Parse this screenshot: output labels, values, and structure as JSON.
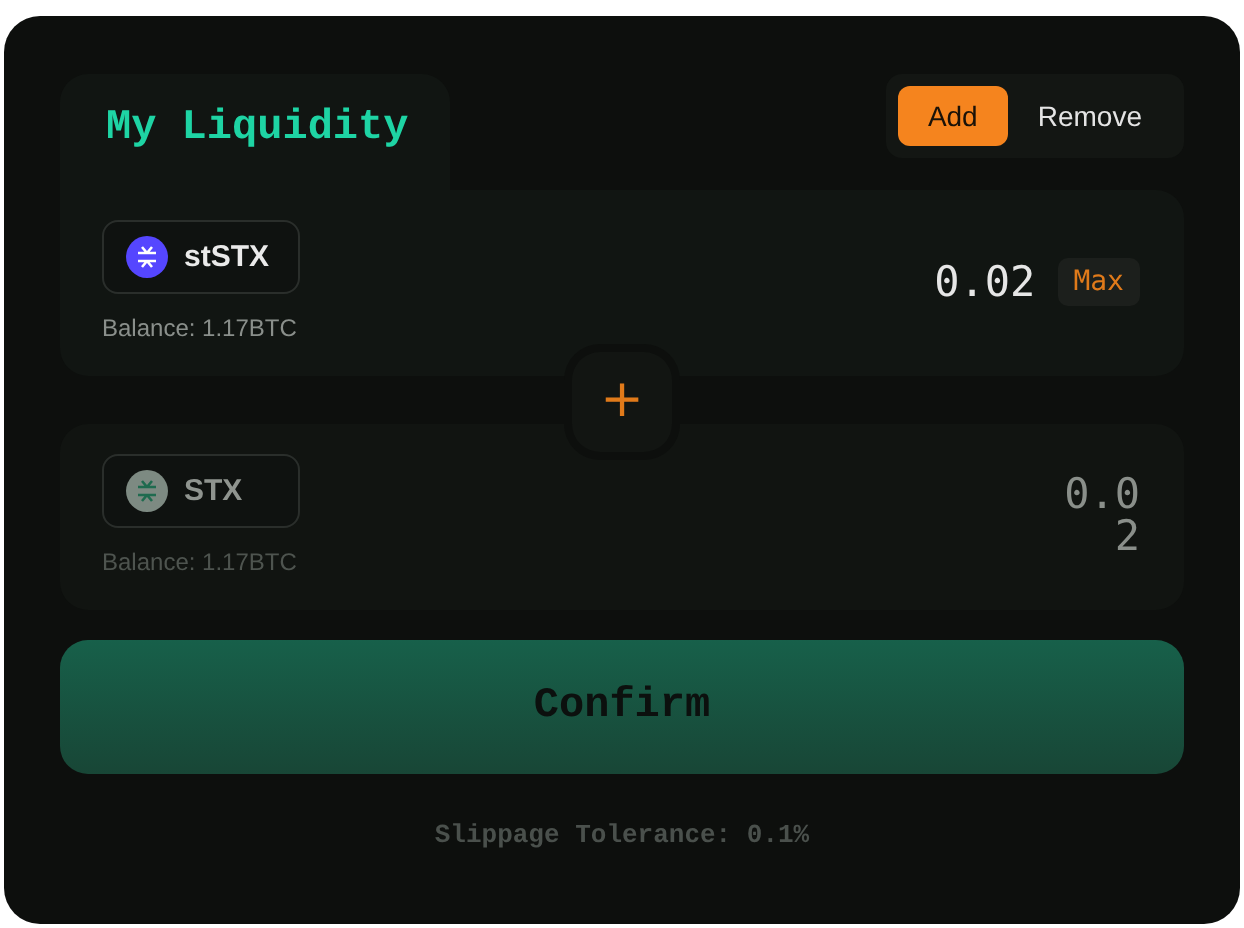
{
  "title": "My Liquidity",
  "modes": [
    {
      "label": "Add",
      "selected": true
    },
    {
      "label": "Remove",
      "selected": false
    }
  ],
  "tokens": [
    {
      "symbol": "stSTX",
      "balance": "Balance: 1.17BTC",
      "amount": "0.02",
      "max": "Max",
      "disabled": false
    },
    {
      "symbol": "STX",
      "balance": "Balance: 1.17BTC",
      "amount": "0.02",
      "disabled": true
    }
  ],
  "plus": "+",
  "confirm": {
    "label": "Confirm",
    "disabled": true
  },
  "footer": "Slippage Tolerance: 0.1%"
}
